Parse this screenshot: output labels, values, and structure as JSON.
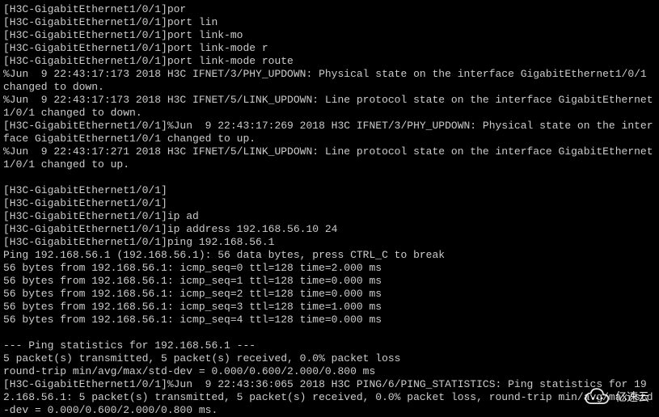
{
  "terminal": {
    "lines": [
      "[H3C-GigabitEthernet1/0/1]por",
      "[H3C-GigabitEthernet1/0/1]port lin",
      "[H3C-GigabitEthernet1/0/1]port link-mo",
      "[H3C-GigabitEthernet1/0/1]port link-mode r",
      "[H3C-GigabitEthernet1/0/1]port link-mode route",
      "%Jun  9 22:43:17:173 2018 H3C IFNET/3/PHY_UPDOWN: Physical state on the interface GigabitEthernet1/0/1 changed to down.",
      "%Jun  9 22:43:17:173 2018 H3C IFNET/5/LINK_UPDOWN: Line protocol state on the interface GigabitEthernet1/0/1 changed to down.",
      "[H3C-GigabitEthernet1/0/1]%Jun  9 22:43:17:269 2018 H3C IFNET/3/PHY_UPDOWN: Physical state on the interface GigabitEthernet1/0/1 changed to up.",
      "%Jun  9 22:43:17:271 2018 H3C IFNET/5/LINK_UPDOWN: Line protocol state on the interface GigabitEthernet1/0/1 changed to up.",
      "",
      "[H3C-GigabitEthernet1/0/1]",
      "[H3C-GigabitEthernet1/0/1]",
      "[H3C-GigabitEthernet1/0/1]ip ad",
      "[H3C-GigabitEthernet1/0/1]ip address 192.168.56.10 24",
      "[H3C-GigabitEthernet1/0/1]ping 192.168.56.1",
      "Ping 192.168.56.1 (192.168.56.1): 56 data bytes, press CTRL_C to break",
      "56 bytes from 192.168.56.1: icmp_seq=0 ttl=128 time=2.000 ms",
      "56 bytes from 192.168.56.1: icmp_seq=1 ttl=128 time=0.000 ms",
      "56 bytes from 192.168.56.1: icmp_seq=2 ttl=128 time=0.000 ms",
      "56 bytes from 192.168.56.1: icmp_seq=3 ttl=128 time=1.000 ms",
      "56 bytes from 192.168.56.1: icmp_seq=4 ttl=128 time=0.000 ms",
      "",
      "--- Ping statistics for 192.168.56.1 ---",
      "5 packet(s) transmitted, 5 packet(s) received, 0.0% packet loss",
      "round-trip min/avg/max/std-dev = 0.000/0.600/2.000/0.800 ms",
      "[H3C-GigabitEthernet1/0/1]%Jun  9 22:43:36:065 2018 H3C PING/6/PING_STATISTICS: Ping statistics for 192.168.56.1: 5 packet(s) transmitted, 5 packet(s) received, 0.0% packet loss, round-trip min/avg/max/std-dev = 0.000/0.600/2.000/0.800 ms."
    ]
  },
  "watermark": {
    "text": "亿速云"
  }
}
